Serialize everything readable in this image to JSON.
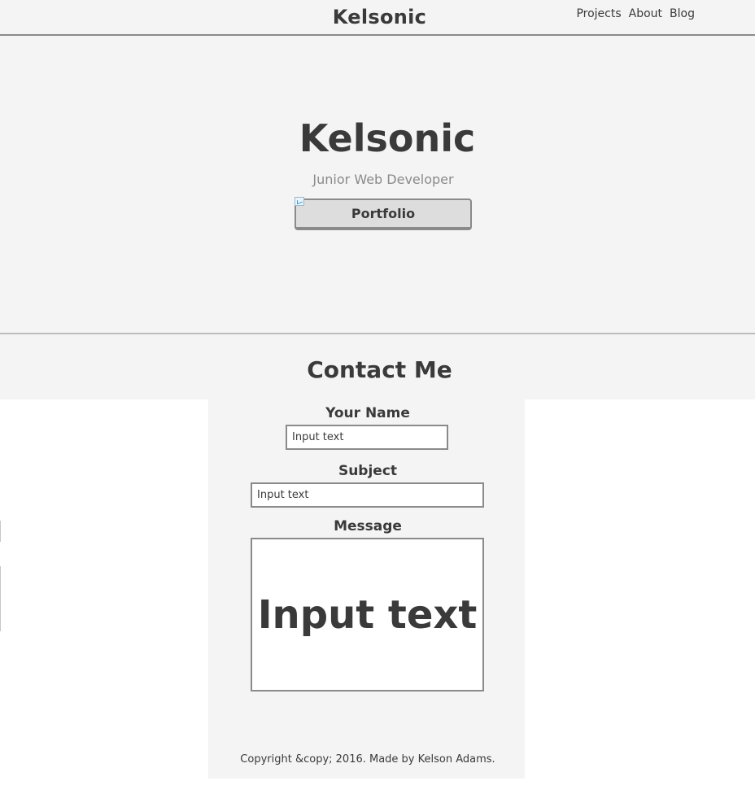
{
  "header": {
    "brand": "Kelsonic",
    "nav": [
      {
        "label": "Projects"
      },
      {
        "label": "About"
      },
      {
        "label": "Blog"
      }
    ]
  },
  "hero": {
    "title": "Kelsonic",
    "subtitle": "Junior Web Developer",
    "button_label": "Portfolio"
  },
  "contact": {
    "title": "Contact Me",
    "name_label": "Your Name",
    "name_placeholder": "Input text",
    "subject_label": "Subject",
    "subject_placeholder": "Input text",
    "message_label": "Message",
    "message_text": "Input text",
    "footer": "Copyright &copy; 2016. Made by Kelson Adams."
  },
  "colors": {
    "background": "#f4f4f4",
    "text": "#3a3a3a",
    "muted": "#8a8a8a",
    "border": "#8a8a8a",
    "button": "#dddddd"
  }
}
